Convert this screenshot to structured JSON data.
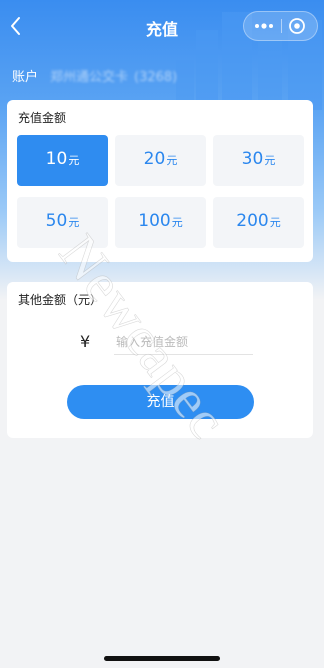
{
  "navbar": {
    "title": "充值",
    "back_icon": "chevron-left-icon",
    "more_icon": "more-dots-icon",
    "close_icon": "capsule-close-icon"
  },
  "account": {
    "label": "账户",
    "card_name": "郑州通公交卡",
    "card_tail": "(3268)"
  },
  "amount_panel": {
    "title": "充值金额",
    "unit": "元",
    "options": [
      {
        "value": "10",
        "selected": true
      },
      {
        "value": "20",
        "selected": false
      },
      {
        "value": "30",
        "selected": false
      },
      {
        "value": "50",
        "selected": false
      },
      {
        "value": "100",
        "selected": false
      },
      {
        "value": "200",
        "selected": false
      }
    ]
  },
  "other_panel": {
    "title": "其他金额（元）",
    "currency_symbol": "¥",
    "input_placeholder": "输入充值金额",
    "input_value": ""
  },
  "submit": {
    "label": "充值"
  },
  "watermark": {
    "text": "Newcapec"
  },
  "colors": {
    "brand_blue": "#2f8cf0",
    "amount_text": "#2b87ee",
    "option_bg": "#f3f5f8",
    "page_bg": "#f2f3f5"
  }
}
